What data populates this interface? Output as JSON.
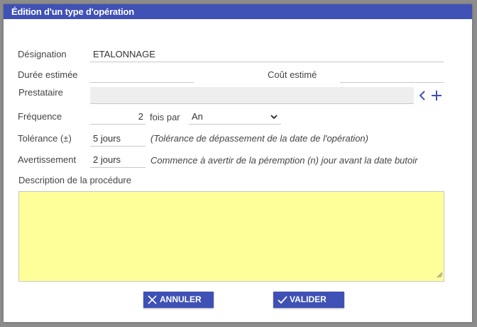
{
  "dialog": {
    "title": "Édition d'un type d'opération"
  },
  "form": {
    "designation": {
      "label": "Désignation",
      "value": "ETALONNAGE"
    },
    "duree": {
      "label": "Durée estimée",
      "value": ""
    },
    "cout": {
      "label": "Coût estimé",
      "value": ""
    },
    "prestataire": {
      "label": "Prestataire",
      "value": ""
    },
    "frequence": {
      "label": "Fréquence",
      "value": "2",
      "fois_label": "fois par",
      "period": "An"
    },
    "tolerance": {
      "label": "Tolérance (±)",
      "value": "5 jours",
      "note": "(Tolérance de dépassement de la date de l'opération)"
    },
    "avertissement": {
      "label": "Avertissement",
      "value": "2 jours",
      "note": "Commence à avertir de la péremption (n) jour avant la date butoir"
    },
    "description": {
      "label": "Description de la procédure",
      "value": ""
    }
  },
  "buttons": {
    "cancel_label": "ANNULER",
    "validate_label": "VALIDER"
  },
  "colors": {
    "primary": "#3f51b5",
    "textarea_bg": "#ffff99",
    "disabled_bg": "#eeeeee"
  },
  "icons": {
    "prestataire_actions": [
      "chevron-left-icon",
      "plus-icon"
    ],
    "period_select": "chevron-down-icon",
    "cancel": "close-icon",
    "validate": "check-icon"
  }
}
